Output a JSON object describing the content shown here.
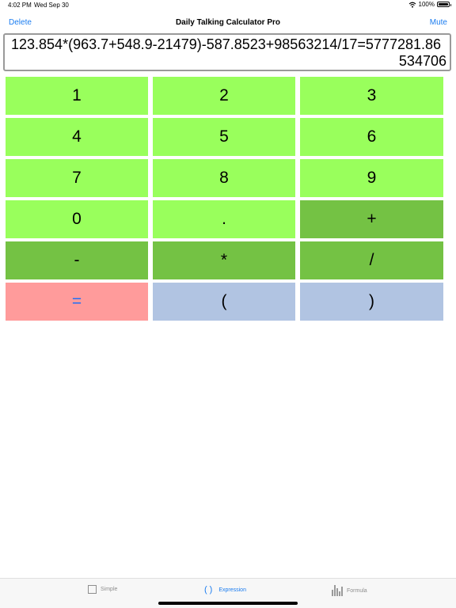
{
  "status": {
    "time": "4:02 PM",
    "date": "Wed Sep 30",
    "battery": "100%"
  },
  "nav": {
    "left": "Delete",
    "title": "Daily Talking Calculator Pro",
    "right": "Mute"
  },
  "display": {
    "expression": "123.854*(963.7+548.9-21479)-587.8523+98563214/17=5777281.86534706"
  },
  "keypad": {
    "keys": [
      "1",
      "2",
      "3",
      "4",
      "5",
      "6",
      "7",
      "8",
      "9",
      "0",
      ".",
      "+",
      "-",
      "*",
      "/",
      "=",
      "(",
      ")"
    ]
  },
  "tabs": [
    {
      "label": "Simple",
      "icon": "square-icon"
    },
    {
      "label": "Expression",
      "icon": "parentheses-icon",
      "active": true
    },
    {
      "label": "Formula",
      "icon": "bar-chart-icon"
    }
  ],
  "colors": {
    "accent": "#1a7cf0",
    "digit_key": "#99ff5c",
    "operator_key": "#74c244",
    "equals_key": "#ff9b9b",
    "paren_key": "#b1c4e2"
  }
}
